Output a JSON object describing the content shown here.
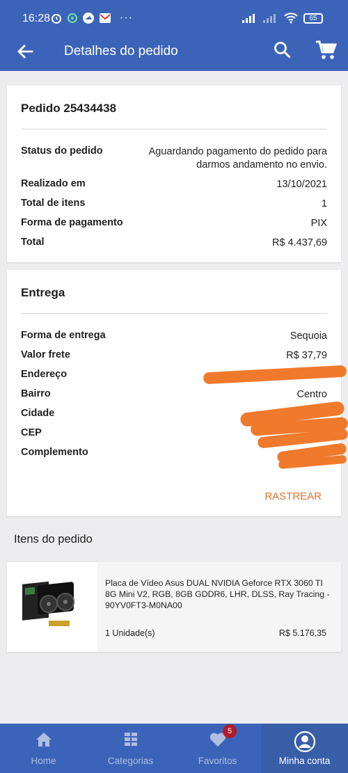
{
  "status_bar": {
    "time": "16:28",
    "battery": "65"
  },
  "app_bar": {
    "title": "Detalhes do pedido"
  },
  "order": {
    "title": "Pedido 25434438",
    "rows": [
      {
        "label": "Status do pedido",
        "value": "Aguardando pagamento do pedido para\ndarmos andamento no envio."
      },
      {
        "label": "Realizado em",
        "value": "13/10/2021"
      },
      {
        "label": "Total de itens",
        "value": "1"
      },
      {
        "label": "Forma de pagamento",
        "value": "PIX"
      },
      {
        "label": "Total",
        "value": "R$ 4.437,69"
      }
    ]
  },
  "delivery": {
    "title": "Entrega",
    "rows": [
      {
        "label": "Forma de entrega",
        "value": "Sequoia"
      },
      {
        "label": "Valor frete",
        "value": "R$ 37,79"
      },
      {
        "label": "Endereço",
        "value": ""
      },
      {
        "label": "Bairro",
        "value": "Centro"
      },
      {
        "label": "Cidade",
        "value": ""
      },
      {
        "label": "CEP",
        "value": ""
      },
      {
        "label": "Complemento",
        "value": ""
      }
    ],
    "track_label": "RASTREAR"
  },
  "items_section": {
    "title": "Itens do pedido",
    "items": [
      {
        "description": "Placa de Vídeo Asus DUAL NVIDIA Geforce RTX 3060 TI 8G Mini V2, RGB, 8GB GDDR6, LHR, DLSS, Ray Tracing - 90YV0FT3-M0NA00",
        "quantity": "1 Unidade(s)",
        "price": "R$ 5.176,35"
      }
    ]
  },
  "bottom_nav": {
    "items": [
      {
        "label": "Home",
        "icon": "home-icon"
      },
      {
        "label": "Categorias",
        "icon": "categories-icon"
      },
      {
        "label": "Favoritos",
        "icon": "heart-icon",
        "badge": "5"
      },
      {
        "label": "Minha conta",
        "icon": "account-icon",
        "active": true
      }
    ]
  },
  "colors": {
    "primary": "#3b64b9",
    "accent": "#e0702a",
    "badge": "#b3192c",
    "redaction": "#f07a2c"
  }
}
